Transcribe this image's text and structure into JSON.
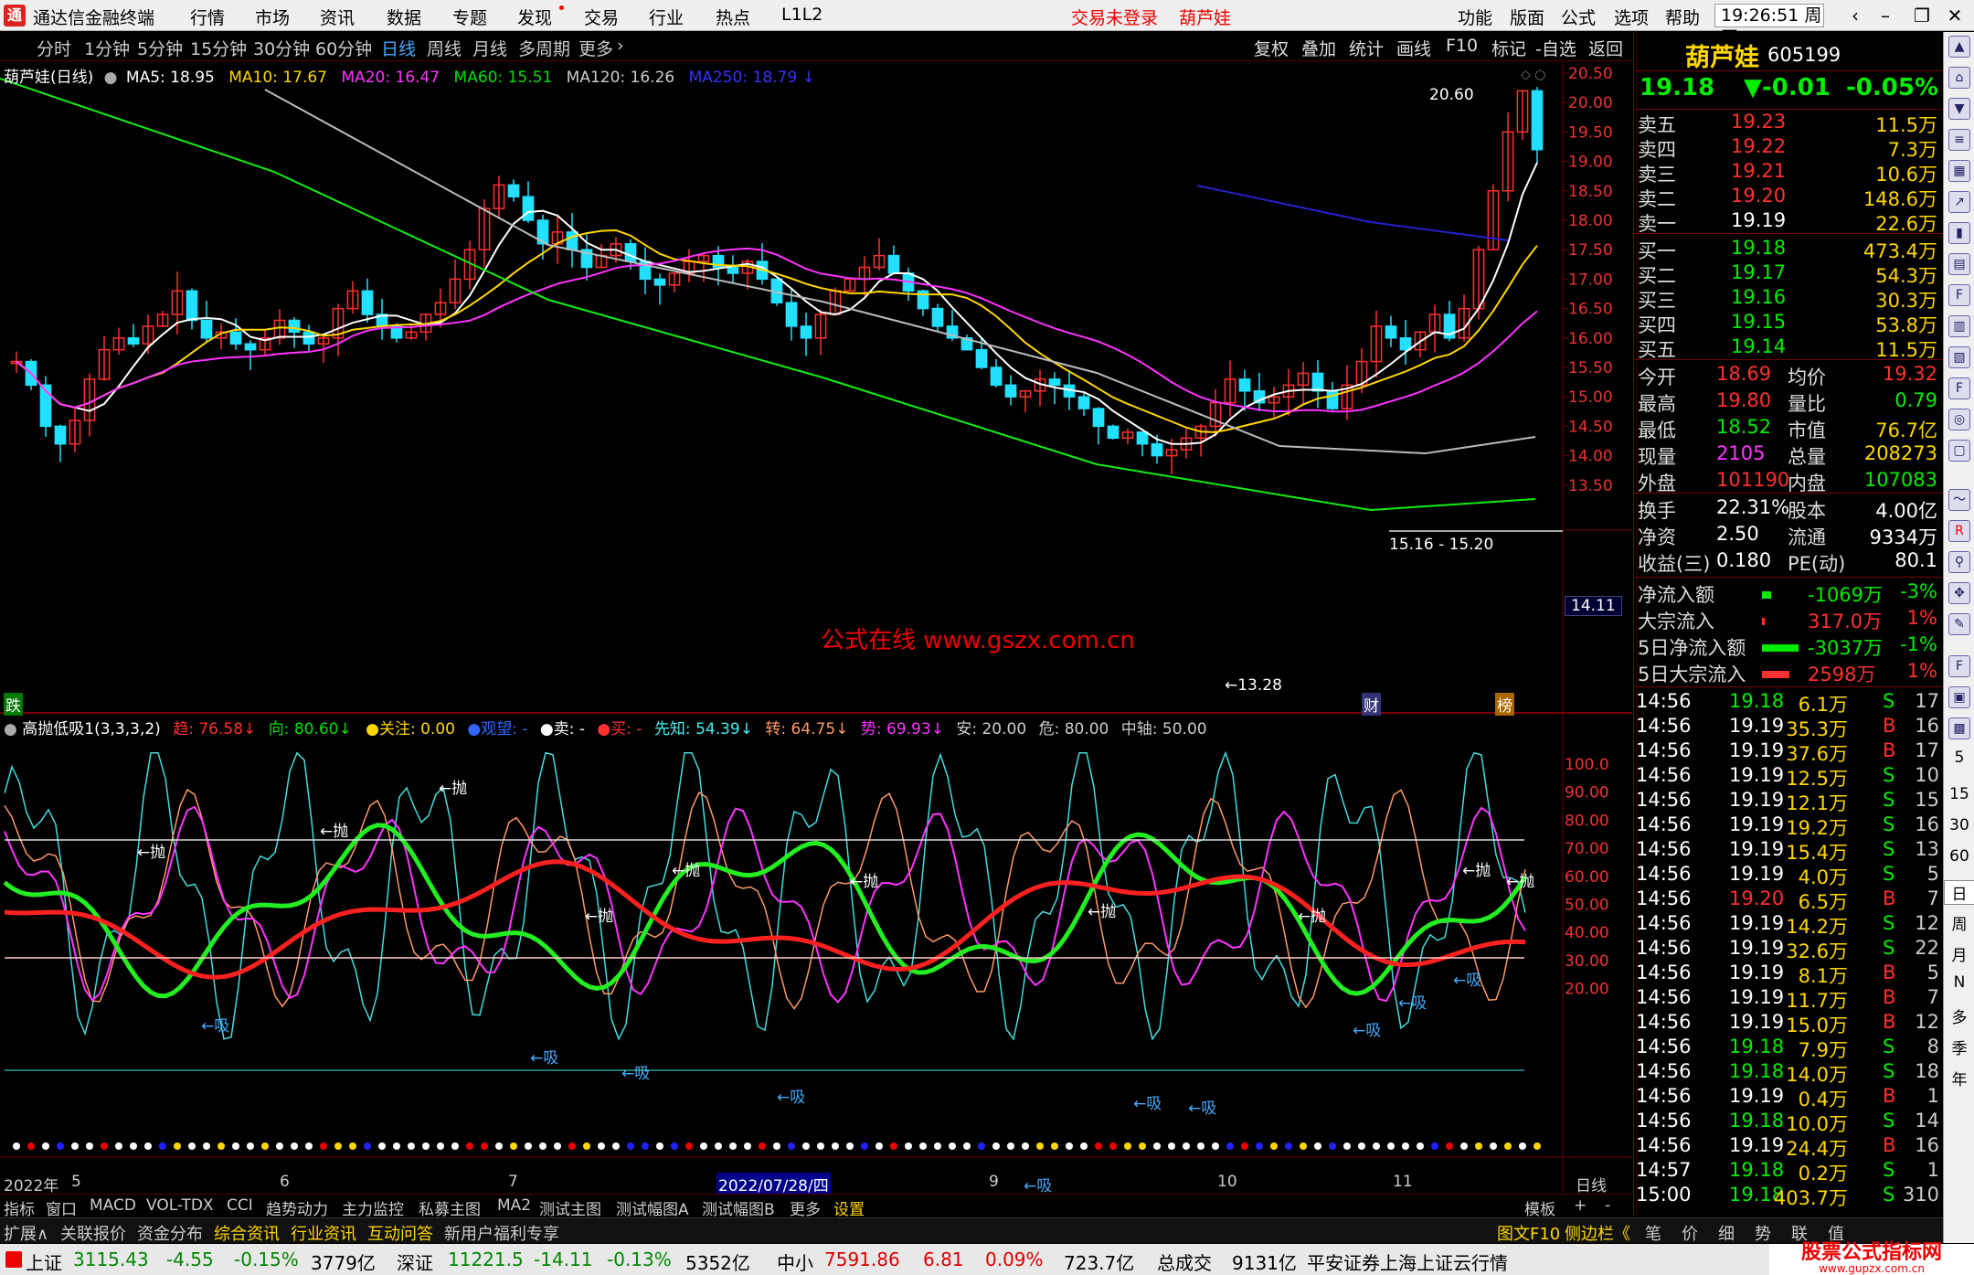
{
  "app": {
    "title": "通达信金融终端",
    "logo": "通"
  },
  "menu": [
    "行情",
    "市场",
    "资讯",
    "数据",
    "专题",
    "发现",
    "交易",
    "行业",
    "热点",
    "L1L2"
  ],
  "menu_status": {
    "not_logged": "交易未登录",
    "stock": "葫芦娃"
  },
  "menu_right": [
    "功能",
    "版面",
    "公式",
    "选项",
    "帮助"
  ],
  "clock": "19:26:51",
  "weekday": "周四",
  "periods": [
    "分时",
    "1分钟",
    "5分钟",
    "15分钟",
    "30分钟",
    "60分钟",
    "日线",
    "周线",
    "月线",
    "多周期",
    "更多"
  ],
  "toolbar_right": [
    "复权",
    "叠加",
    "统计",
    "画线",
    "F10",
    "标记",
    "-自选",
    "返回"
  ],
  "ma_legend": {
    "name": "葫芦娃(日线)",
    "ma5": "MA5: 18.95",
    "ma10": "MA10: 17.67",
    "ma20": "MA20: 16.47",
    "ma60": "MA60: 15.51",
    "ma120": "MA120: 16.26",
    "ma250": "MA250: 18.79"
  },
  "ind_legend": {
    "name": "高抛低吸1(3,3,3,2)",
    "trend": "趋: 76.58",
    "dir": "向: 80.60",
    "watch": "●关注: 0.00",
    "hope": "●观望: -",
    "sell": "●卖: -",
    "buy": "●买: -",
    "know": "先知: 54.39",
    "turn": "转: 64.75",
    "shi": "势: 69.93",
    "safe": "安: 20.00",
    "danger": "危: 80.00",
    "mid": "中轴: 50.00"
  },
  "price_axis": [
    "20.50",
    "20.00",
    "19.50",
    "19.00",
    "18.50",
    "18.00",
    "17.50",
    "17.00",
    "16.50",
    "16.00",
    "15.50",
    "15.00",
    "14.50",
    "14.00",
    "13.50"
  ],
  "ind_axis": [
    "100.0",
    "90.00",
    "80.00",
    "70.00",
    "60.00",
    "50.00",
    "40.00",
    "30.00",
    "20.00"
  ],
  "annotations": {
    "high": "20.60",
    "low": "←13.28",
    "range": "15.16 - 15.20",
    "cur_price_tag": "14.11",
    "watermark": "公式在线 www.gszx.com.cn",
    "die": "跌",
    "cai": "财",
    "bang": "榜"
  },
  "date_axis": {
    "year": "2022年",
    "m5": "5",
    "m6": "6",
    "m7": "7",
    "sel": "2022/07/28/四",
    "m9": "9",
    "m10": "10",
    "m11": "11",
    "period": "日线"
  },
  "signals": {
    "sell": "←抛",
    "buy": "←吸"
  },
  "bottom_tabs": [
    "指标",
    "窗口",
    "MACD",
    "VOL-TDX",
    "CCI",
    "趋势动力",
    "主力监控",
    "私募主图",
    "MA2",
    "测试主图",
    "测试幅图A",
    "测试幅图B",
    "更多",
    "设置"
  ],
  "bottom_right": {
    "tpl": "模板",
    "plus": "+",
    "minus": "-"
  },
  "bottom_links": [
    "扩展∧",
    "关联报价",
    "资金分布",
    "综合资讯",
    "行业资讯",
    "互动问答",
    "新用户福利专享"
  ],
  "bottom_links_right": [
    "图文F10",
    "侧边栏《",
    "笔",
    "价",
    "细",
    "势",
    "联",
    "值"
  ],
  "status": {
    "sh_name": "上证",
    "sh_val": "3115.43",
    "sh_chg": "-4.55",
    "sh_pct": "-0.15%",
    "sh_amt": "3779亿",
    "sz_name": "深证",
    "sz_val": "11221.5",
    "sz_chg": "-14.11",
    "sz_pct": "-0.13%",
    "sz_amt": "5352亿",
    "zx_name": "中小",
    "zx_val": "7591.86",
    "zx_chg": "6.81",
    "zx_pct": "0.09%",
    "zx_amt": "723.7亿",
    "total_label": "总成交",
    "total_val": "9131亿",
    "broker": "平安证券上海上证云行情",
    "site": "股票公式指标网",
    "site_url": "www.gupzx.com.cn"
  },
  "quote": {
    "name": "葫芦娃",
    "code": "605199",
    "price": "19.18",
    "chg": "▼-0.01",
    "pct": "-0.05%",
    "asks": [
      {
        "l": "卖五",
        "p": "19.23",
        "v": "11.5万"
      },
      {
        "l": "卖四",
        "p": "19.22",
        "v": "7.3万"
      },
      {
        "l": "卖三",
        "p": "19.21",
        "v": "10.6万"
      },
      {
        "l": "卖二",
        "p": "19.20",
        "v": "148.6万"
      },
      {
        "l": "卖一",
        "p": "19.19",
        "v": "22.6万"
      }
    ],
    "bids": [
      {
        "l": "买一",
        "p": "19.18",
        "v": "473.4万"
      },
      {
        "l": "买二",
        "p": "19.17",
        "v": "54.3万"
      },
      {
        "l": "买三",
        "p": "19.16",
        "v": "30.3万"
      },
      {
        "l": "买四",
        "p": "19.15",
        "v": "53.8万"
      },
      {
        "l": "买五",
        "p": "19.14",
        "v": "11.5万"
      }
    ],
    "stats": [
      [
        "今开",
        "18.69",
        "均价",
        "19.32"
      ],
      [
        "最高",
        "19.80",
        "量比",
        "0.79"
      ],
      [
        "最低",
        "18.52",
        "市值",
        "76.7亿"
      ],
      [
        "现量",
        "2105",
        "总量",
        "208273"
      ],
      [
        "外盘",
        "101190",
        "内盘",
        "107083"
      ]
    ],
    "fin": [
      [
        "换手",
        "22.31%",
        "股本",
        "4.00亿"
      ],
      [
        "净资",
        "2.50",
        "流通",
        "9334万"
      ],
      [
        "收益(三)",
        "0.180",
        "PE(动)",
        "80.1"
      ]
    ],
    "flow": [
      [
        "净流入额",
        "-1069万",
        "-3%"
      ],
      [
        "大宗流入",
        "317.0万",
        "1%"
      ],
      [
        "5日净流入额",
        "-3037万",
        "-1%"
      ],
      [
        "5日大宗流入",
        "2598万",
        "1%"
      ]
    ],
    "ticks": [
      [
        "14:56",
        "19.18",
        "6.1万",
        "S",
        "17"
      ],
      [
        "14:56",
        "19.19",
        "35.3万",
        "B",
        "16"
      ],
      [
        "14:56",
        "19.19",
        "37.6万",
        "B",
        "17"
      ],
      [
        "14:56",
        "19.19",
        "12.5万",
        "S",
        "10"
      ],
      [
        "14:56",
        "19.19",
        "12.1万",
        "S",
        "15"
      ],
      [
        "14:56",
        "19.19",
        "19.2万",
        "S",
        "16"
      ],
      [
        "14:56",
        "19.19",
        "15.4万",
        "S",
        "13"
      ],
      [
        "14:56",
        "19.19",
        "4.0万",
        "S",
        "5"
      ],
      [
        "14:56",
        "19.20",
        "6.5万",
        "B",
        "7"
      ],
      [
        "14:56",
        "19.19",
        "14.2万",
        "S",
        "12"
      ],
      [
        "14:56",
        "19.19",
        "32.6万",
        "S",
        "22"
      ],
      [
        "14:56",
        "19.19",
        "8.1万",
        "B",
        "5"
      ],
      [
        "14:56",
        "19.19",
        "11.7万",
        "B",
        "7"
      ],
      [
        "14:56",
        "19.19",
        "15.0万",
        "B",
        "12"
      ],
      [
        "14:56",
        "19.18",
        "7.9万",
        "S",
        "8"
      ],
      [
        "14:56",
        "19.18",
        "14.0万",
        "S",
        "18"
      ],
      [
        "14:56",
        "19.19",
        "0.4万",
        "B",
        "1"
      ],
      [
        "14:56",
        "19.18",
        "10.0万",
        "S",
        "14"
      ],
      [
        "14:56",
        "19.19",
        "24.4万",
        "B",
        "16"
      ],
      [
        "14:57",
        "19.18",
        "0.2万",
        "S",
        "1"
      ],
      [
        "15:00",
        "19.18",
        "403.7万",
        "S",
        "310"
      ]
    ]
  },
  "sidebar_text": [
    "日",
    "周",
    "月",
    "N",
    "多",
    "季",
    "年"
  ],
  "sidebar_nums": [
    "15",
    "30",
    "60"
  ]
}
